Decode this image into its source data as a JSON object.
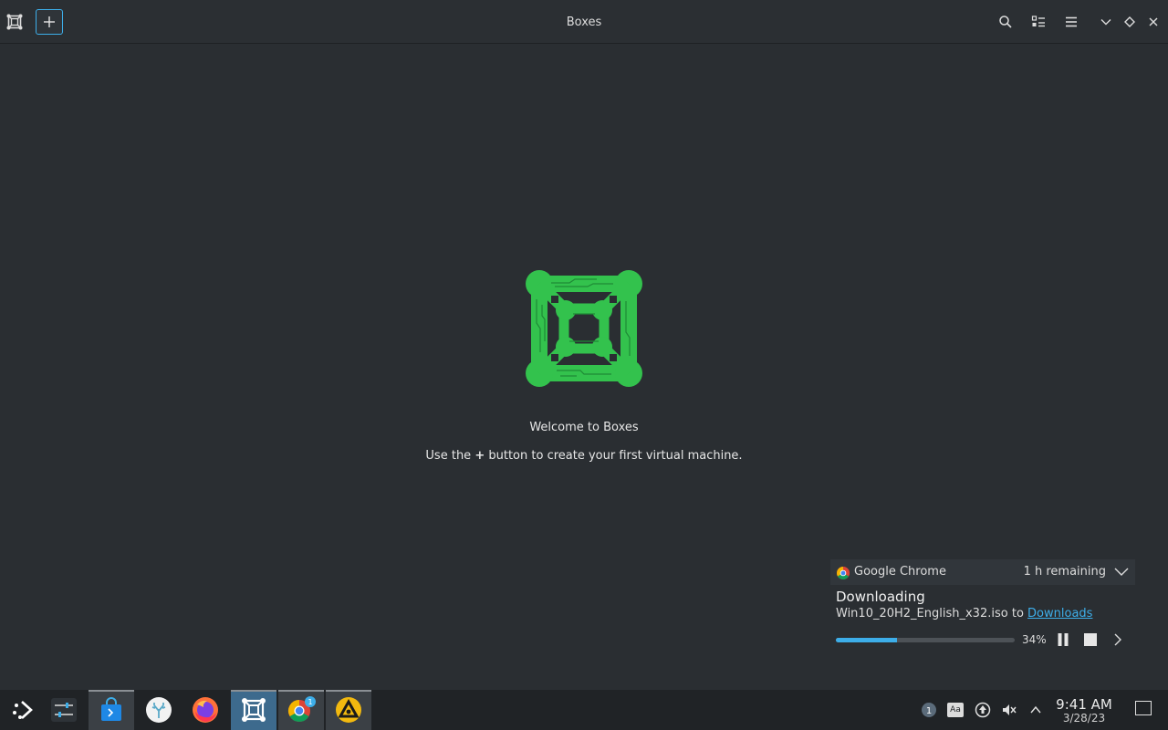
{
  "window": {
    "title": "Boxes",
    "app_icon": "boxes-icon",
    "new_button_icon": "plus-icon",
    "toolbar_icons": [
      "search-icon",
      "selection-mode-icon",
      "hamburger-menu-icon"
    ],
    "window_controls": [
      "minimize-icon",
      "maximize-icon",
      "close-icon"
    ]
  },
  "welcome": {
    "title": "Welcome to Boxes",
    "subtitle_prefix": "Use the",
    "subtitle_symbol": "+",
    "subtitle_suffix": "button to create your first virtual machine.",
    "logo_color": "#33c24d"
  },
  "notification": {
    "app_name": "Google Chrome",
    "remaining": "1 h remaining",
    "title": "Downloading",
    "file_name": "Win10_20H2_English_x32.iso",
    "to_text": "to",
    "destination": "Downloads",
    "progress_percent": 34,
    "progress_label": "34%",
    "controls": [
      "pause-icon",
      "stop-icon",
      "chevron-right-icon"
    ]
  },
  "taskbar": {
    "apps": [
      {
        "name": "application-launcher",
        "icon": "launcher-icon"
      },
      {
        "name": "system-settings",
        "icon": "settings-sliders-icon"
      },
      {
        "name": "discover-store",
        "icon": "store-bag-icon"
      },
      {
        "name": "steam-deck-coral",
        "icon": "coral-icon"
      },
      {
        "name": "firefox",
        "icon": "firefox-icon"
      },
      {
        "name": "boxes",
        "icon": "boxes-icon"
      },
      {
        "name": "google-chrome",
        "icon": "chrome-icon",
        "badge": "1"
      },
      {
        "name": "emudeck",
        "icon": "emudeck-icon"
      }
    ],
    "tray": {
      "update_badge": "1",
      "input_method_label": "Aa",
      "icons": [
        "updates-icon",
        "input-method-icon",
        "network-icon",
        "volume-muted-icon",
        "tray-expand-icon"
      ]
    },
    "clock": {
      "time": "9:41 AM",
      "date": "3/28/23"
    }
  },
  "colors": {
    "accent": "#3daee9",
    "background": "#2a2e32",
    "taskbar": "#202326",
    "boxes_green": "#33c24d"
  }
}
